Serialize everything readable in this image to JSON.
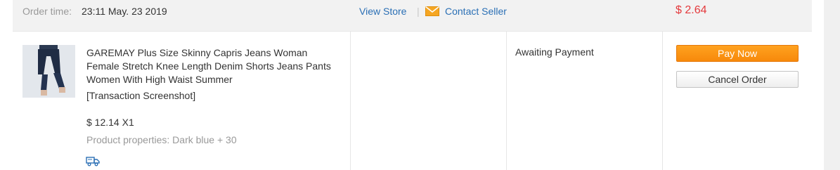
{
  "order": {
    "time_label": "Order time:",
    "time_value": "23:11 May. 23 2019",
    "view_store": "View Store",
    "separator": "|",
    "contact_seller": "Contact Seller",
    "amount": "$ 2.64",
    "product": {
      "title": "GAREMAY Plus Size Skinny Capris Jeans Woman Female Stretch Knee Length Denim Shorts Jeans Pants Women With High Waist Summer",
      "snapshot": "[Transaction Screenshot]",
      "price_qty": "$ 12.14 X1",
      "properties": "Product properties: Dark blue + 30",
      "thumbnail_icon": "product-thumbnail",
      "shipping_icon": "delivery-truck-icon"
    },
    "status": "Awaiting Payment",
    "actions": {
      "pay_now": "Pay Now",
      "cancel_order": "Cancel Order"
    }
  },
  "colors": {
    "link": "#2a6fb5",
    "price": "#e4393c",
    "pay_button": "#f7890b",
    "header_bg": "#f2f2f2",
    "mail_icon": "#f5a623"
  }
}
